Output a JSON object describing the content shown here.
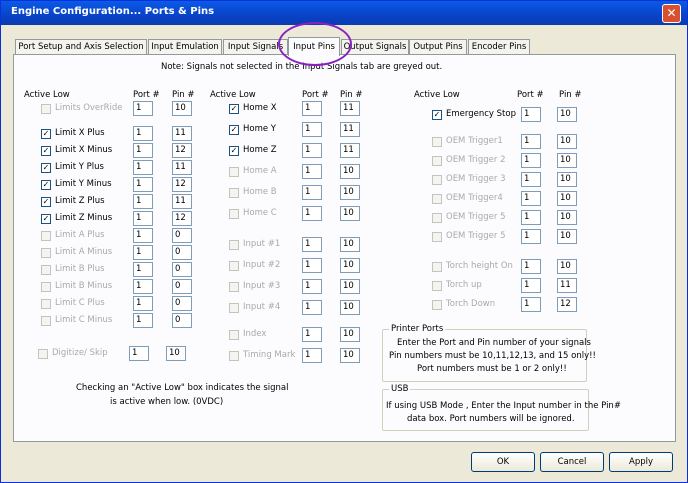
{
  "window": {
    "title": "Engine Configuration... Ports & Pins",
    "close_glyph": "✕"
  },
  "tabs": [
    {
      "label": "Port Setup and Axis Selection"
    },
    {
      "label": "Input Emulation"
    },
    {
      "label": "Input Signals"
    },
    {
      "label": "Input Pins",
      "active": true
    },
    {
      "label": "Output Signals"
    },
    {
      "label": "Output Pins"
    },
    {
      "label": "Encoder Pins"
    }
  ],
  "note": "Note: Signals not selected in the Input Signals tab are greyed out.",
  "headers": {
    "active_low": "Active Low",
    "port": "Port #",
    "pin": "Pin #"
  },
  "col1": [
    {
      "name": "Limits OverRide",
      "checked": false,
      "enabled": false,
      "port": "1",
      "pin": "10"
    },
    {
      "name": "Limit X Plus",
      "checked": true,
      "enabled": true,
      "port": "1",
      "pin": "11"
    },
    {
      "name": "Limit X Minus",
      "checked": true,
      "enabled": true,
      "port": "1",
      "pin": "12"
    },
    {
      "name": "Limit Y Plus",
      "checked": true,
      "enabled": true,
      "port": "1",
      "pin": "11"
    },
    {
      "name": "Limit Y Minus",
      "checked": true,
      "enabled": true,
      "port": "1",
      "pin": "12"
    },
    {
      "name": "Limit Z Plus",
      "checked": true,
      "enabled": true,
      "port": "1",
      "pin": "11"
    },
    {
      "name": "Limit Z Minus",
      "checked": true,
      "enabled": true,
      "port": "1",
      "pin": "12"
    },
    {
      "name": "Limit A Plus",
      "checked": false,
      "enabled": false,
      "port": "1",
      "pin": "0"
    },
    {
      "name": "Limit A Minus",
      "checked": false,
      "enabled": false,
      "port": "1",
      "pin": "0"
    },
    {
      "name": "Limit B Plus",
      "checked": false,
      "enabled": false,
      "port": "1",
      "pin": "0"
    },
    {
      "name": "Limit B Minus",
      "checked": false,
      "enabled": false,
      "port": "1",
      "pin": "0"
    },
    {
      "name": "Limit C Plus",
      "checked": false,
      "enabled": false,
      "port": "1",
      "pin": "0"
    },
    {
      "name": "Limit C Minus",
      "checked": false,
      "enabled": false,
      "port": "1",
      "pin": "0"
    }
  ],
  "digitize": {
    "name": "Digitize/ Skip",
    "checked": false,
    "enabled": false,
    "port": "1",
    "pin": "10"
  },
  "col2": [
    {
      "name": "Home X",
      "checked": true,
      "enabled": true,
      "port": "1",
      "pin": "11"
    },
    {
      "name": "Home Y",
      "checked": true,
      "enabled": true,
      "port": "1",
      "pin": "11"
    },
    {
      "name": "Home Z",
      "checked": true,
      "enabled": true,
      "port": "1",
      "pin": "11"
    },
    {
      "name": "Home A",
      "checked": false,
      "enabled": false,
      "port": "1",
      "pin": "10"
    },
    {
      "name": "Home B",
      "checked": false,
      "enabled": false,
      "port": "1",
      "pin": "10"
    },
    {
      "name": "Home C",
      "checked": false,
      "enabled": false,
      "port": "1",
      "pin": "10"
    },
    {
      "name": "Input #1",
      "checked": false,
      "enabled": false,
      "port": "1",
      "pin": "10"
    },
    {
      "name": "Input #2",
      "checked": false,
      "enabled": false,
      "port": "1",
      "pin": "10"
    },
    {
      "name": "Input #3",
      "checked": false,
      "enabled": false,
      "port": "1",
      "pin": "10"
    },
    {
      "name": "Input #4",
      "checked": false,
      "enabled": false,
      "port": "1",
      "pin": "10"
    },
    {
      "name": "Index",
      "checked": false,
      "enabled": false,
      "port": "1",
      "pin": "10"
    },
    {
      "name": "Timing Mark",
      "checked": false,
      "enabled": false,
      "port": "1",
      "pin": "10"
    }
  ],
  "col3": [
    {
      "name": "Emergency Stop",
      "checked": true,
      "enabled": true,
      "port": "1",
      "pin": "10"
    },
    {
      "name": "OEM Trigger1",
      "checked": false,
      "enabled": false,
      "port": "1",
      "pin": "10"
    },
    {
      "name": "OEM Trigger 2",
      "checked": false,
      "enabled": false,
      "port": "1",
      "pin": "10"
    },
    {
      "name": "OEM Trigger 3",
      "checked": false,
      "enabled": false,
      "port": "1",
      "pin": "10"
    },
    {
      "name": "OEM Trigger4",
      "checked": false,
      "enabled": false,
      "port": "1",
      "pin": "10"
    },
    {
      "name": "OEM Trigger 5",
      "checked": false,
      "enabled": false,
      "port": "1",
      "pin": "10"
    },
    {
      "name": "OEM Trigger 5",
      "checked": false,
      "enabled": false,
      "port": "1",
      "pin": "10"
    },
    {
      "name": "Torch height On",
      "checked": false,
      "enabled": false,
      "port": "1",
      "pin": "10"
    },
    {
      "name": "Torch up",
      "checked": false,
      "enabled": false,
      "port": "1",
      "pin": "11"
    },
    {
      "name": "Torch Down",
      "checked": false,
      "enabled": false,
      "port": "1",
      "pin": "12"
    }
  ],
  "active_low_note": [
    "Checking an \"Active Low\" box indicates the signal",
    "is active when low. (0VDC)"
  ],
  "printer_ports": {
    "title": "Printer Ports",
    "lines": [
      "Enter the Port and Pin number of your signals",
      "Pin numbers must be 10,11,12,13, and 15 only!!",
      "Port numbers must be 1 or 2 only!!"
    ]
  },
  "usb": {
    "title": "USB",
    "lines": [
      "If using USB Mode , Enter the Input number in the Pin#",
      "data box. Port numbers will be ignored."
    ]
  },
  "buttons": {
    "ok": "OK",
    "cancel": "Cancel",
    "apply": "Apply"
  },
  "colors": {
    "title_bar": "#0a4ed8",
    "annotation_circle": "#8a22c0",
    "disabled_text": "#a9a9a9"
  }
}
